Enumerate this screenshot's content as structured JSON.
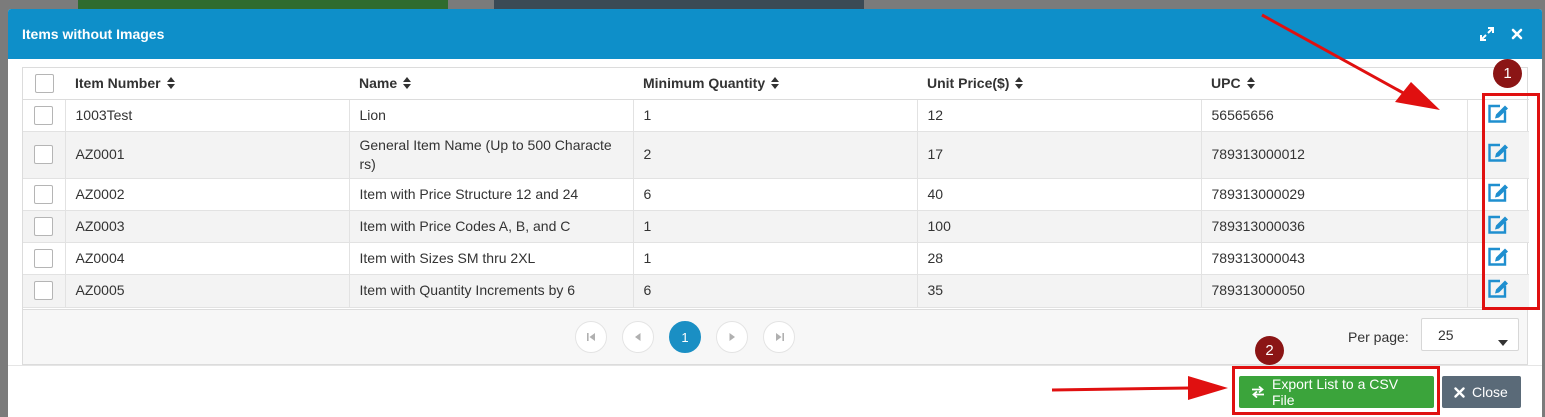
{
  "modal": {
    "title": "Items without Images",
    "maximize_icon": "expand-icon",
    "close_icon": "close-icon"
  },
  "table": {
    "columns": [
      "Item Number",
      "Name",
      "Minimum Quantity",
      "Unit Price($)",
      "UPC"
    ],
    "rows": [
      {
        "item_number": "1003Test",
        "name": "Lion",
        "min_qty": "1",
        "unit_price": "12",
        "upc": "56565656"
      },
      {
        "item_number": "AZ0001",
        "name": "General Item Name (Up to 500 Characte rs)",
        "min_qty": "2",
        "unit_price": "17",
        "upc": "789313000012"
      },
      {
        "item_number": "AZ0002",
        "name": "Item with Price Structure 12 and 24",
        "min_qty": "6",
        "unit_price": "40",
        "upc": "789313000029"
      },
      {
        "item_number": "AZ0003",
        "name": "Item with Price Codes A, B, and C",
        "min_qty": "1",
        "unit_price": "100",
        "upc": "789313000036"
      },
      {
        "item_number": "AZ0004",
        "name": "Item with Sizes SM thru 2XL",
        "min_qty": "1",
        "unit_price": "28",
        "upc": "789313000043"
      },
      {
        "item_number": "AZ0005",
        "name": "Item with Quantity Increments by 6",
        "min_qty": "6",
        "unit_price": "35",
        "upc": "789313000050"
      }
    ],
    "edit_icon": "edit-icon"
  },
  "pager": {
    "current_page": "1",
    "per_page_label": "Per page:",
    "per_page_value": "25"
  },
  "footer": {
    "export_label": "Export List to a CSV File",
    "close_label": "Close"
  },
  "annotations": {
    "badge_1": "1",
    "badge_2": "2"
  },
  "colors": {
    "header": "#0e8fc9",
    "export_button": "#3ba43b",
    "close_button": "#5a6a78",
    "annotation_red": "#e01010",
    "edit_icon": "#1f8fcf"
  }
}
